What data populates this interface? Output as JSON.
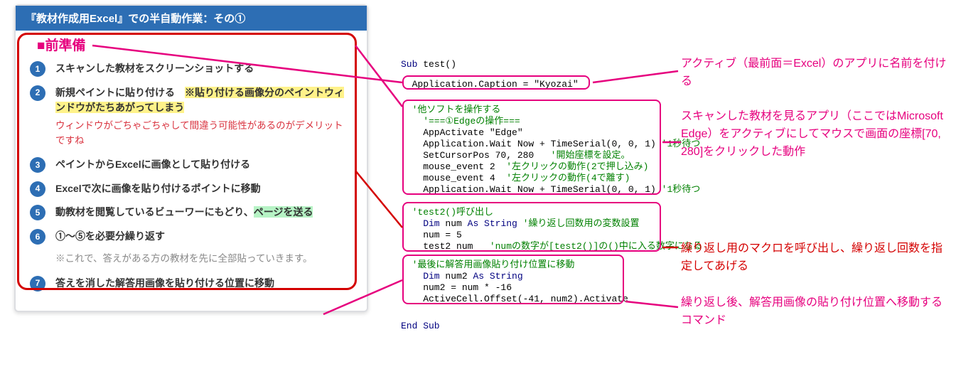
{
  "panel": {
    "header": "『教材作成用Excel』での半自動作業：その①",
    "section_title": "■前準備",
    "items": [
      {
        "n": "1",
        "text": "スキャンした教材をスクリーンショットする"
      },
      {
        "n": "2",
        "a": "新規ペイントに貼り付ける　",
        "b_hl": "※貼り付ける画像分のペイントウィンドウがたちあがってしまう",
        "red": "ウィンドウがごちゃごちゃして間違う可能性があるのがデメリットですね"
      },
      {
        "n": "3",
        "text": "ペイントからExcelに画像として貼り付ける"
      },
      {
        "n": "4",
        "text": "Excelで次に画像を貼り付けるポイントに移動"
      },
      {
        "n": "5",
        "a": "動教材を閲覧しているビューワーにもどり、",
        "b_hl": "ページを送る"
      },
      {
        "n": "6",
        "text": "①～⑤を必要分繰り返す",
        "gray": "※これで、答えがある方の教材を先に全部貼っていきます。"
      },
      {
        "n": "7",
        "text": "答えを消した解答用画像を貼り付ける位置に移動"
      }
    ]
  },
  "code": {
    "l0a": "Sub ",
    "l0b": "test()",
    "l1": "  Application.Caption = \"Kyozai\"",
    "l2": "  '他ソフトを操作する",
    "l3": "    '===①Edgeの操作===",
    "l4": "    AppActivate \"Edge\"",
    "l5a": "    Application.Wait Now + TimeSerial(0, 0, 1) ",
    "l5b": "'1秒待つ",
    "l6a": "    SetCursorPos 70, 280   ",
    "l6b": "'開始座標を設定。",
    "l7a": "    mouse_event 2  ",
    "l7b": "'左クリックの動作(2で押し込み)",
    "l8a": "    mouse_event 4  ",
    "l8b": "'左クリックの動作(4で離す)",
    "l9a": "    Application.Wait Now + TimeSerial(0, 0, 1) ",
    "l9b": "'1秒待つ",
    "l10": "  'test2()呼び出し",
    "l11a": "    Dim ",
    "l11b": "num ",
    "l11c": "As String ",
    "l11d": "'繰り返し回数用の変数設置",
    "l12": "    num = 5",
    "l13a": "    test2 num   ",
    "l13b": "'numの数字が[test2()]の()中に入る数字になる",
    "l14": "  '最後に解答用画像貼り付け位置に移動",
    "l15a": "    Dim ",
    "l15b": "num2 ",
    "l15c": "As String",
    "l16": "    num2 = num * -16",
    "l17": "    ActiveCell.Offset(-41, num2).Activate",
    "l18": "End Sub"
  },
  "annotations": {
    "a1": "アクティブ（最前面＝Excel）のアプリに名前を付ける",
    "a2": "スキャンした教材を見るアプリ（ここではMicrosoft Edge）をアクティブにしてマウスで画面の座標[70, 280]をクリックした動作",
    "a3": "繰り返し用のマクロを呼び出し、繰り返し回数を指定してあげる",
    "a4": "繰り返し後、解答用画像の貼り付け位置へ移動するコマンド"
  }
}
